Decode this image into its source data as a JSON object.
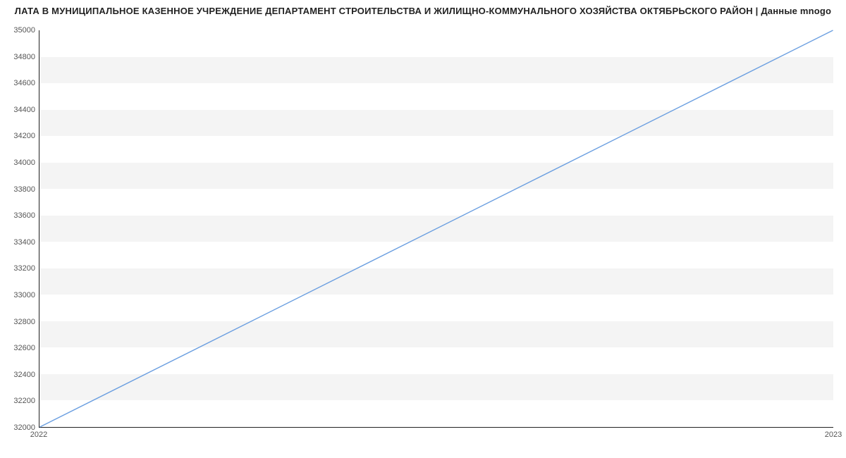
{
  "chart_data": {
    "type": "line",
    "title": "ЛАТА В МУНИЦИПАЛЬНОЕ КАЗЕННОЕ УЧРЕЖДЕНИЕ ДЕПАРТАМЕНТ СТРОИТЕЛЬСТВА И ЖИЛИЩНО-КОММУНАЛЬНОГО ХОЗЯЙСТВА ОКТЯБРЬСКОГО РАЙОН | Данные mnogo",
    "x": [
      2022,
      2023
    ],
    "values": [
      32000,
      35000
    ],
    "xlabel": "",
    "ylabel": "",
    "ylim": [
      32000,
      35000
    ],
    "y_ticks": [
      32000,
      32200,
      32400,
      32600,
      32800,
      33000,
      33200,
      33400,
      33600,
      33800,
      34000,
      34200,
      34400,
      34600,
      34800,
      35000
    ],
    "x_ticks": [
      2022,
      2023
    ],
    "line_color": "#6a9ee0"
  }
}
